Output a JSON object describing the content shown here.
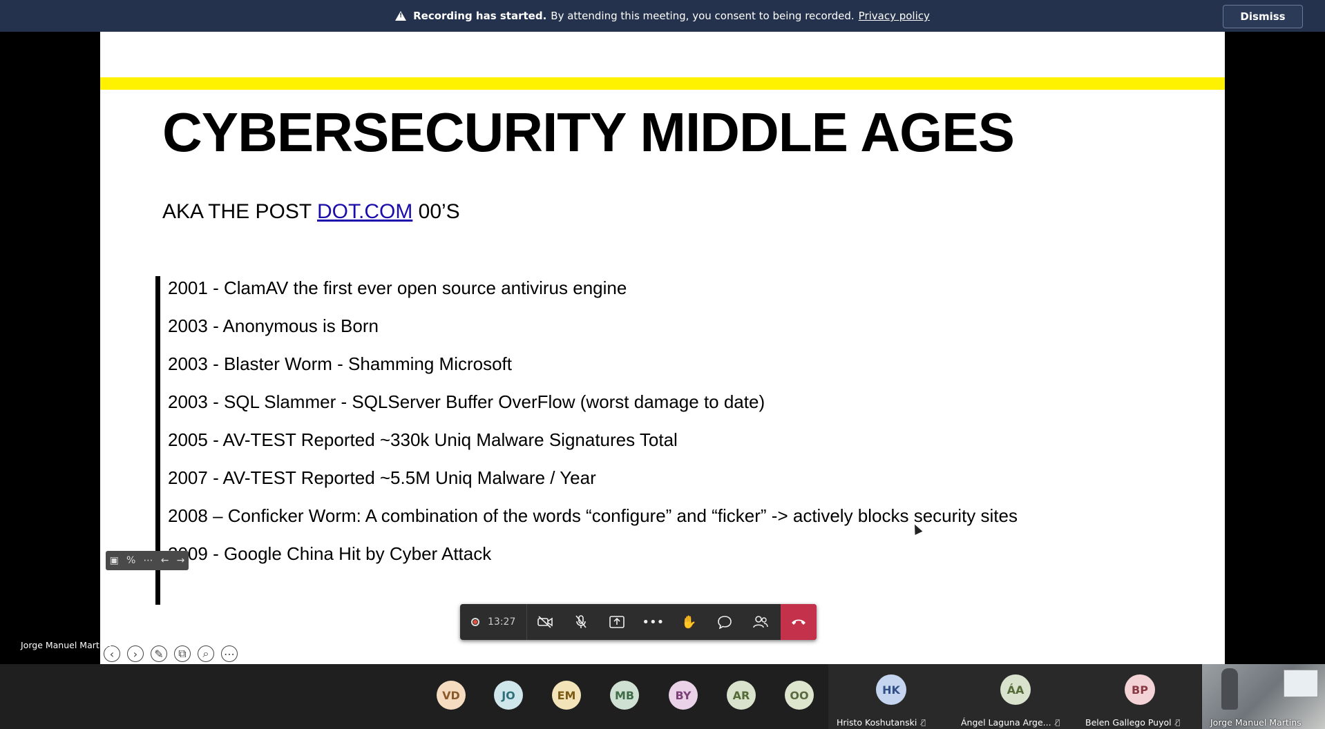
{
  "banner": {
    "bold": "Recording has started.",
    "text": "By attending this meeting, you consent to being recorded.",
    "link": "Privacy policy",
    "dismiss": "Dismiss"
  },
  "slide": {
    "title": "CYBERSECURITY MIDDLE AGES",
    "subtitle_pre": "AKA THE POST ",
    "subtitle_link": "DOT.COM",
    "subtitle_post": " 00’S",
    "items": [
      "2001 - ClamAV the first ever open source antivirus engine",
      "2003 - Anonymous is Born",
      "2003 - Blaster Worm - Shamming Microsoft",
      "2003 - SQL Slammer - SQLServer Buffer OverFlow (worst damage to date)",
      "2005 - AV-TEST Reported ~330k Uniq Malware Signatures Total",
      "2007 - AV-TEST Reported ~5.5M Uniq Malware / Year",
      "2008 – Conficker Worm:  A combination of the words “configure” and “ficker” -> actively blocks security sites",
      "2009 - Google China Hit by Cyber Attack"
    ]
  },
  "presenter": "Jorge Manuel Martins",
  "toolbar": {
    "timer": "13:27",
    "hangup_color": "#c4314b"
  },
  "participants": {
    "avatars": [
      {
        "initials": "VD",
        "bg": "#f5dcc0",
        "fg": "#8a5a2b"
      },
      {
        "initials": "JO",
        "bg": "#cfe6ea",
        "fg": "#2f6f7a"
      },
      {
        "initials": "EM",
        "bg": "#f3e3b8",
        "fg": "#7a5a14"
      },
      {
        "initials": "MB",
        "bg": "#cfe1d2",
        "fg": "#3f6b47"
      },
      {
        "initials": "BY",
        "bg": "#ead3e8",
        "fg": "#7d3f78"
      },
      {
        "initials": "AR",
        "bg": "#d9e2cc",
        "fg": "#556b37"
      },
      {
        "initials": "OO",
        "bg": "#dde5cf",
        "fg": "#5a6a3f"
      }
    ],
    "tiles": [
      {
        "initials": "HK",
        "name": "Hristo Koshutanski",
        "bg": "#c5d4ef",
        "fg": "#2f4f86"
      },
      {
        "initials": "ÁA",
        "name": "Ángel Laguna Arge...",
        "bg": "#d9e2cc",
        "fg": "#556b37"
      },
      {
        "initials": "BP",
        "name": "Belen Gallego Puyol",
        "bg": "#f3d3d6",
        "fg": "#8a3a44"
      }
    ],
    "video_name": "Jorge Manuel Martins"
  }
}
